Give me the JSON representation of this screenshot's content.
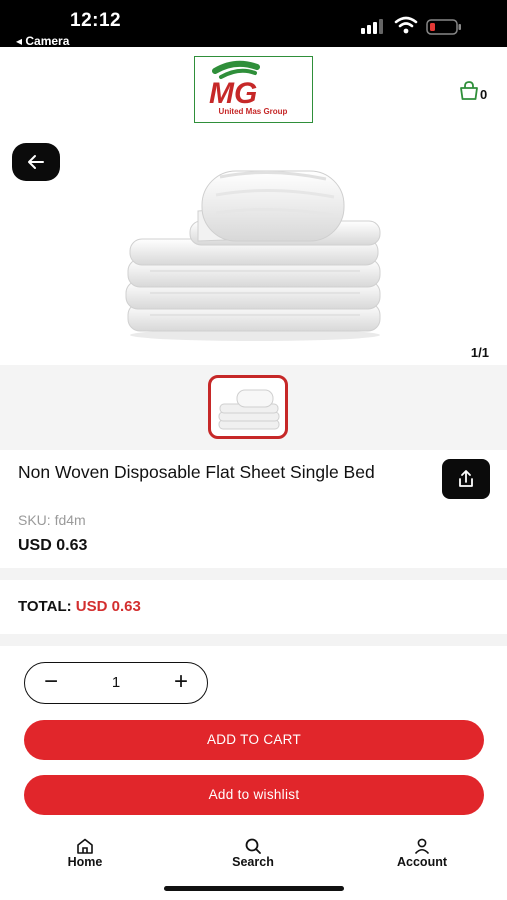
{
  "status_bar": {
    "time": "12:12",
    "back_app": "◂ Camera",
    "signal_icon": "cellular-signal-icon",
    "wifi_icon": "wifi-icon",
    "battery_icon": "battery-low-icon"
  },
  "header": {
    "logo_text": "MG",
    "logo_subtext": "United Mas Group",
    "cart_icon": "shopping-bag-icon",
    "cart_count": "0"
  },
  "gallery": {
    "back_icon": "arrow-left-icon",
    "image_subject": "stack of white towels",
    "pager": "1/1",
    "thumbnails": [
      "towels-thumbnail"
    ]
  },
  "product": {
    "title": "Non Woven Disposable Flat Sheet Single Bed",
    "sku": "SKU: fd4m",
    "price": "USD 0.63",
    "share_icon": "share-icon"
  },
  "summary": {
    "total_label": "TOTAL:",
    "total_value": "USD 0.63"
  },
  "quantity": {
    "minus": "−",
    "value": "1",
    "plus": "+"
  },
  "actions": {
    "add_to_cart": "ADD TO CART",
    "add_to_wishlist": "Add to wishlist"
  },
  "bottom_nav": {
    "items": [
      {
        "label": "Home",
        "icon": "home-icon"
      },
      {
        "label": "Search",
        "icon": "search-icon"
      },
      {
        "label": "Account",
        "icon": "user-icon"
      }
    ]
  },
  "colors": {
    "accent": "#e1262b",
    "price_red": "#d32f2f",
    "logo_green": "#2f8f3a",
    "dark": "#0b0b0b"
  }
}
